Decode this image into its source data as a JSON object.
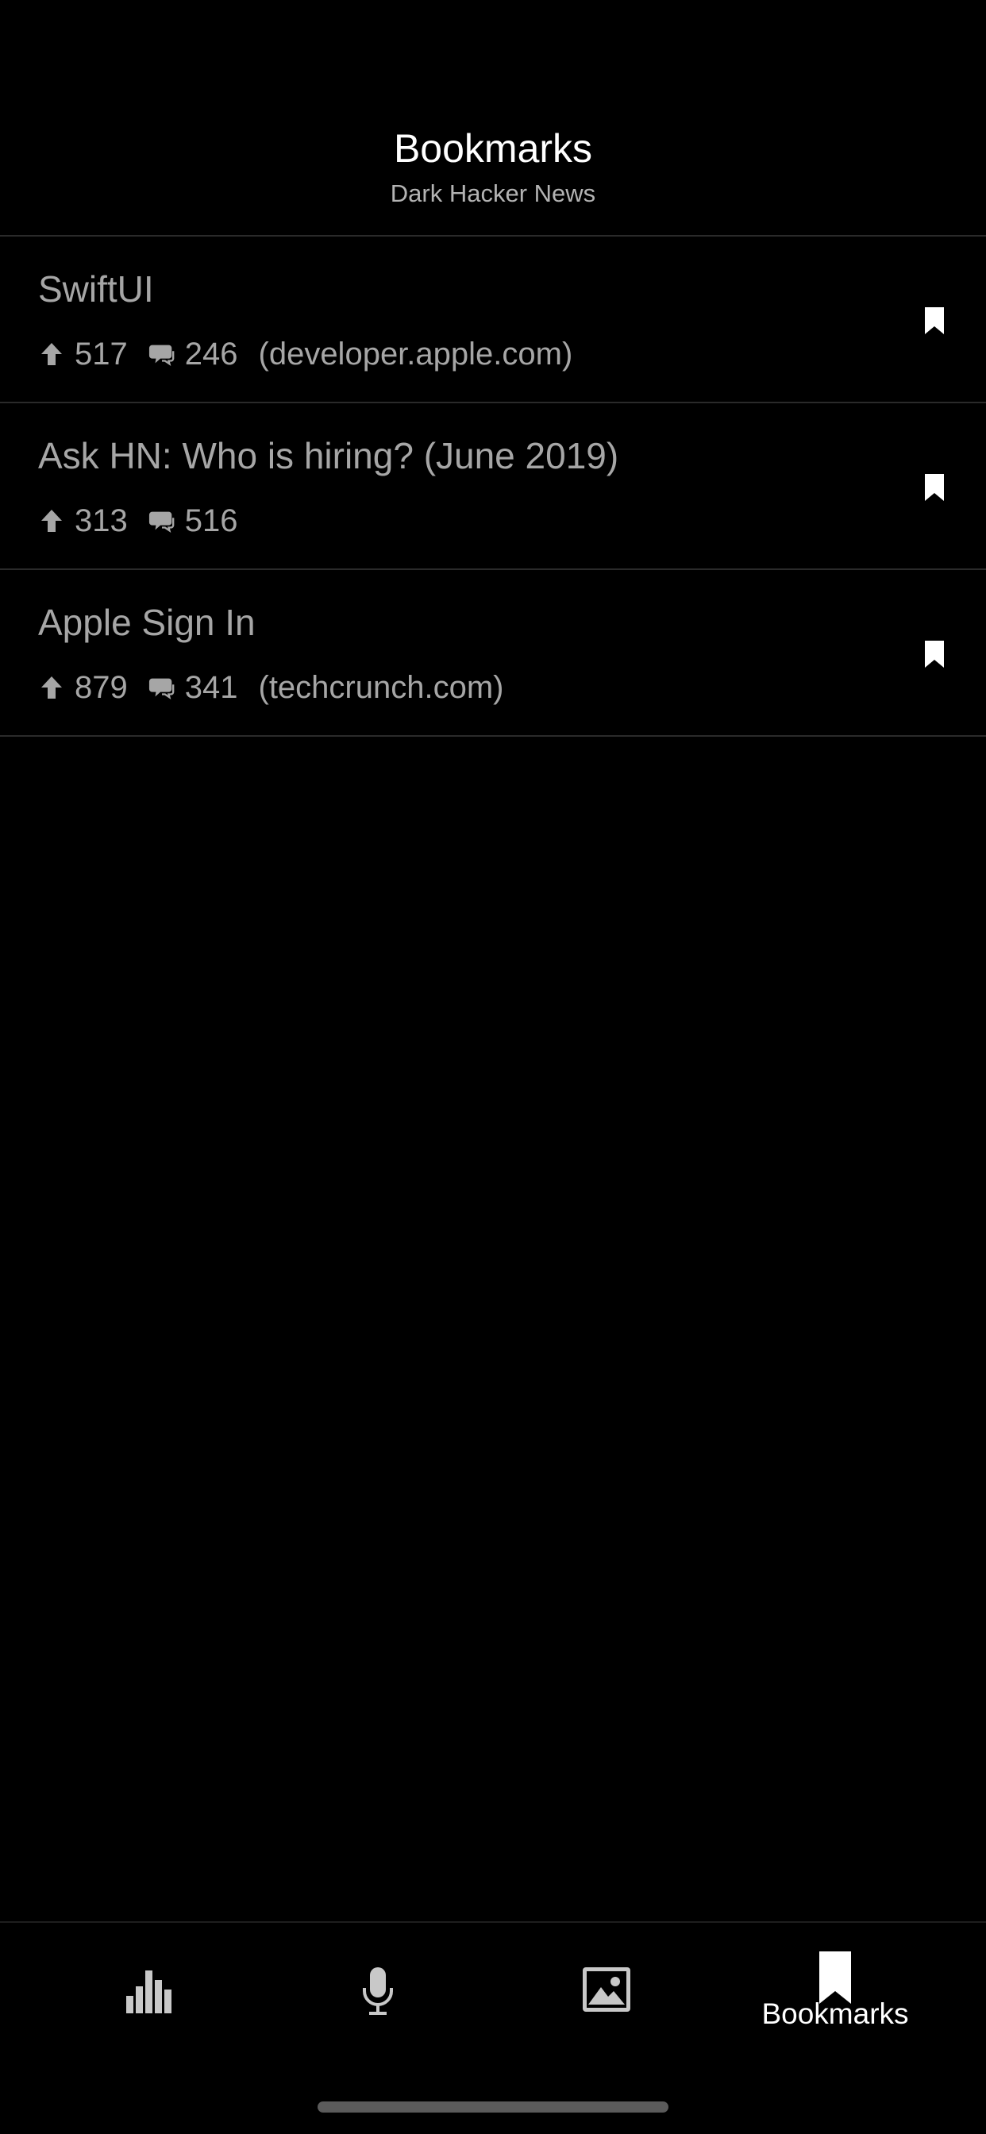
{
  "header": {
    "title": "Bookmarks",
    "subtitle": "Dark Hacker News"
  },
  "items": [
    {
      "title": "SwiftUI",
      "points": "517",
      "comments": "246",
      "domain": "(developer.apple.com)"
    },
    {
      "title": "Ask HN: Who is hiring? (June 2019)",
      "points": "313",
      "comments": "516",
      "domain": ""
    },
    {
      "title": "Apple Sign In",
      "points": "879",
      "comments": "341",
      "domain": "(techcrunch.com)"
    }
  ],
  "tabbar": {
    "tabs": [
      {
        "icon": "bar-chart-icon",
        "label": ""
      },
      {
        "icon": "microphone-icon",
        "label": ""
      },
      {
        "icon": "photo-icon",
        "label": ""
      },
      {
        "icon": "bookmark-icon",
        "label": "Bookmarks",
        "active": true
      }
    ]
  },
  "colors": {
    "background": "#000000",
    "text_primary": "#ffffff",
    "text_secondary": "#a6a6a6",
    "divider": "#2a2a2a",
    "inactive_icon": "#c8c8c8"
  }
}
